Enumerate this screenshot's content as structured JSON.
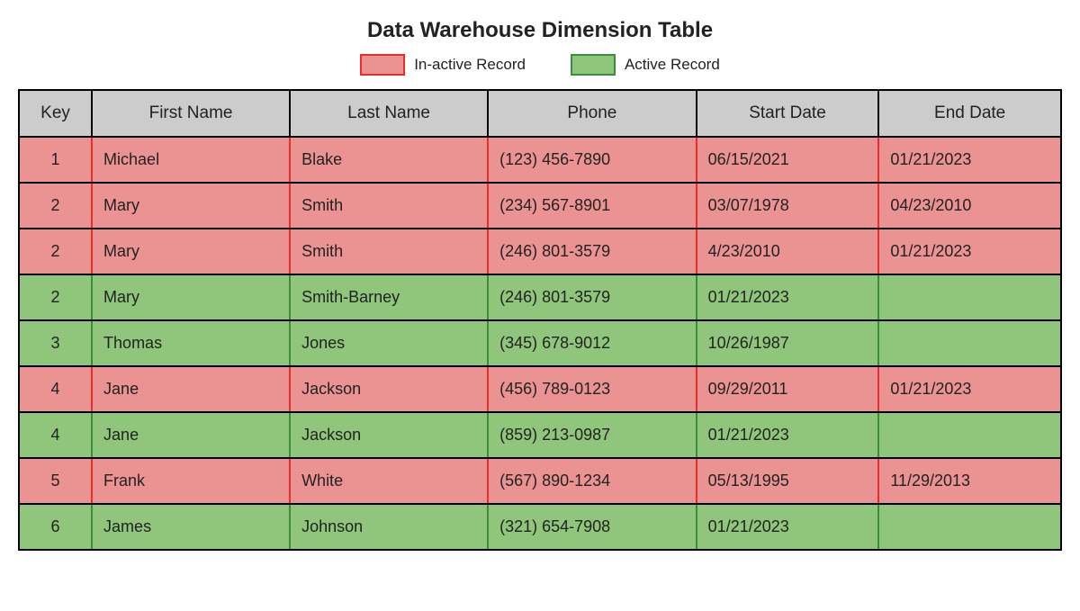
{
  "title": "Data Warehouse Dimension Table",
  "legend": {
    "inactive_label": "In-active Record",
    "active_label": "Active Record"
  },
  "colors": {
    "inactive_fill": "#eb9393",
    "inactive_border": "#ee2b2b",
    "active_fill": "#90c67b",
    "active_border": "#388e3c",
    "header_fill": "#cccccc"
  },
  "columns": [
    "Key",
    "First Name",
    "Last Name",
    "Phone",
    "Start Date",
    "End Date"
  ],
  "rows": [
    {
      "status": "inactive",
      "key": "1",
      "first_name": "Michael",
      "last_name": "Blake",
      "phone": "(123) 456-7890",
      "start_date": "06/15/2021",
      "end_date": "01/21/2023"
    },
    {
      "status": "inactive",
      "key": "2",
      "first_name": "Mary",
      "last_name": "Smith",
      "phone": "(234) 567-8901",
      "start_date": "03/07/1978",
      "end_date": "04/23/2010"
    },
    {
      "status": "inactive",
      "key": "2",
      "first_name": "Mary",
      "last_name": "Smith",
      "phone": "(246) 801-3579",
      "start_date": "4/23/2010",
      "end_date": "01/21/2023"
    },
    {
      "status": "active",
      "key": "2",
      "first_name": "Mary",
      "last_name": "Smith-Barney",
      "phone": "(246) 801-3579",
      "start_date": "01/21/2023",
      "end_date": ""
    },
    {
      "status": "active",
      "key": "3",
      "first_name": "Thomas",
      "last_name": "Jones",
      "phone": "(345) 678-9012",
      "start_date": "10/26/1987",
      "end_date": ""
    },
    {
      "status": "inactive",
      "key": "4",
      "first_name": "Jane",
      "last_name": "Jackson",
      "phone": "(456) 789-0123",
      "start_date": "09/29/2011",
      "end_date": "01/21/2023"
    },
    {
      "status": "active",
      "key": "4",
      "first_name": "Jane",
      "last_name": "Jackson",
      "phone": "(859) 213-0987",
      "start_date": "01/21/2023",
      "end_date": ""
    },
    {
      "status": "inactive",
      "key": "5",
      "first_name": "Frank",
      "last_name": "White",
      "phone": "(567) 890-1234",
      "start_date": "05/13/1995",
      "end_date": "11/29/2013"
    },
    {
      "status": "active",
      "key": "6",
      "first_name": "James",
      "last_name": "Johnson",
      "phone": "(321) 654-7908",
      "start_date": "01/21/2023",
      "end_date": ""
    }
  ]
}
